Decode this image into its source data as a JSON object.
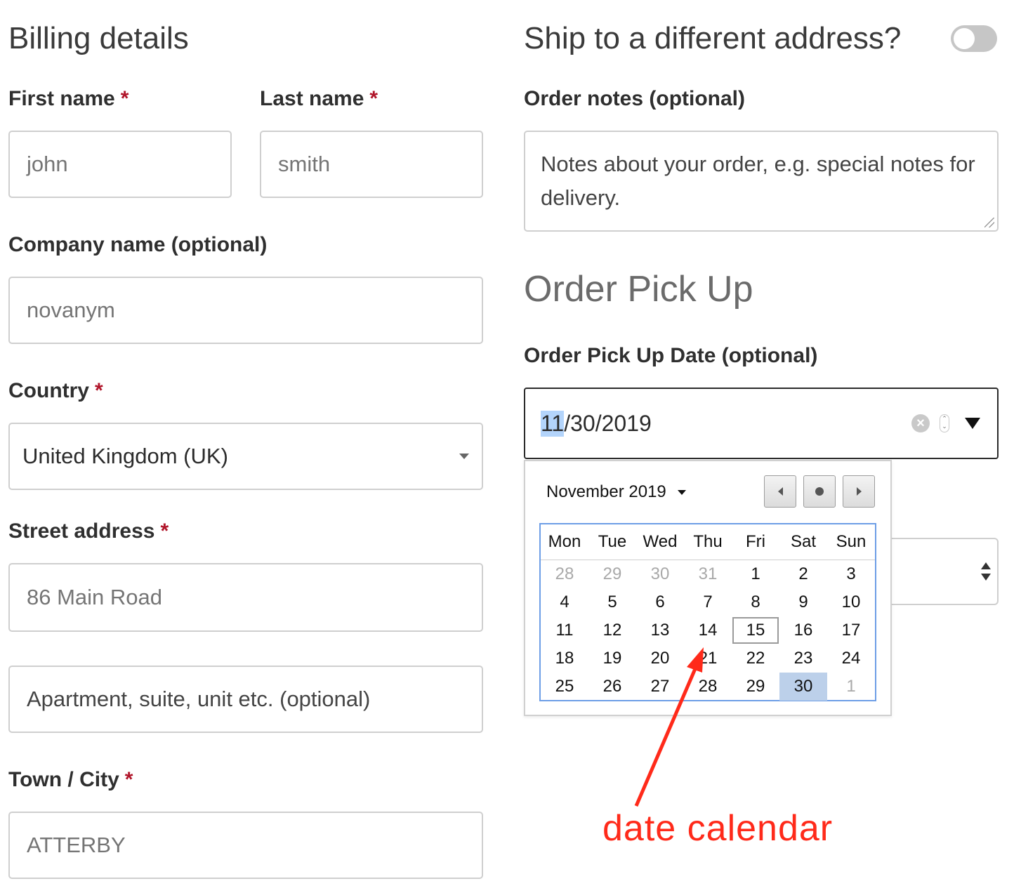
{
  "billing": {
    "title": "Billing details",
    "required_mark": "*",
    "first_name": {
      "label": "First name",
      "placeholder": "john"
    },
    "last_name": {
      "label": "Last name",
      "placeholder": "smith"
    },
    "company": {
      "label": "Company name (optional)",
      "placeholder": "novanym"
    },
    "country": {
      "label": "Country",
      "value": "United Kingdom (UK)"
    },
    "street": {
      "label": "Street address",
      "placeholder": "86  Main Road",
      "apartment_placeholder": "Apartment, suite, unit etc. (optional)"
    },
    "city": {
      "label": "Town / City",
      "placeholder": "ATTERBY"
    }
  },
  "shipping": {
    "title": "Ship to a different address?",
    "toggle_on": false
  },
  "order_notes": {
    "label": "Order notes (optional)",
    "placeholder": "Notes about your order, e.g. special notes for delivery."
  },
  "pickup": {
    "title": "Order Pick Up",
    "date_label": "Order Pick Up Date (optional)",
    "date_month": "11",
    "date_rest": "/30/2019"
  },
  "calendar": {
    "month_label": "November 2019",
    "weekdays": [
      "Mon",
      "Tue",
      "Wed",
      "Thu",
      "Fri",
      "Sat",
      "Sun"
    ],
    "weeks": [
      [
        "28",
        "29",
        "30",
        "31",
        "1",
        "2",
        "3"
      ],
      [
        "4",
        "5",
        "6",
        "7",
        "8",
        "9",
        "10"
      ],
      [
        "11",
        "12",
        "13",
        "14",
        "15",
        "16",
        "17"
      ],
      [
        "18",
        "19",
        "20",
        "21",
        "22",
        "23",
        "24"
      ],
      [
        "25",
        "26",
        "27",
        "28",
        "29",
        "30",
        "1"
      ]
    ],
    "muted": [
      [
        0,
        0
      ],
      [
        0,
        1
      ],
      [
        0,
        2
      ],
      [
        0,
        3
      ],
      [
        4,
        6
      ]
    ],
    "today": [
      2,
      4
    ],
    "selected": [
      4,
      5
    ]
  },
  "annotation": {
    "text": "date calendar",
    "color": "#ff2a1a"
  },
  "colors": {
    "required": "#b0152a",
    "selected_day": "#bcd0ea",
    "calendar_border": "#6d9ee6"
  }
}
